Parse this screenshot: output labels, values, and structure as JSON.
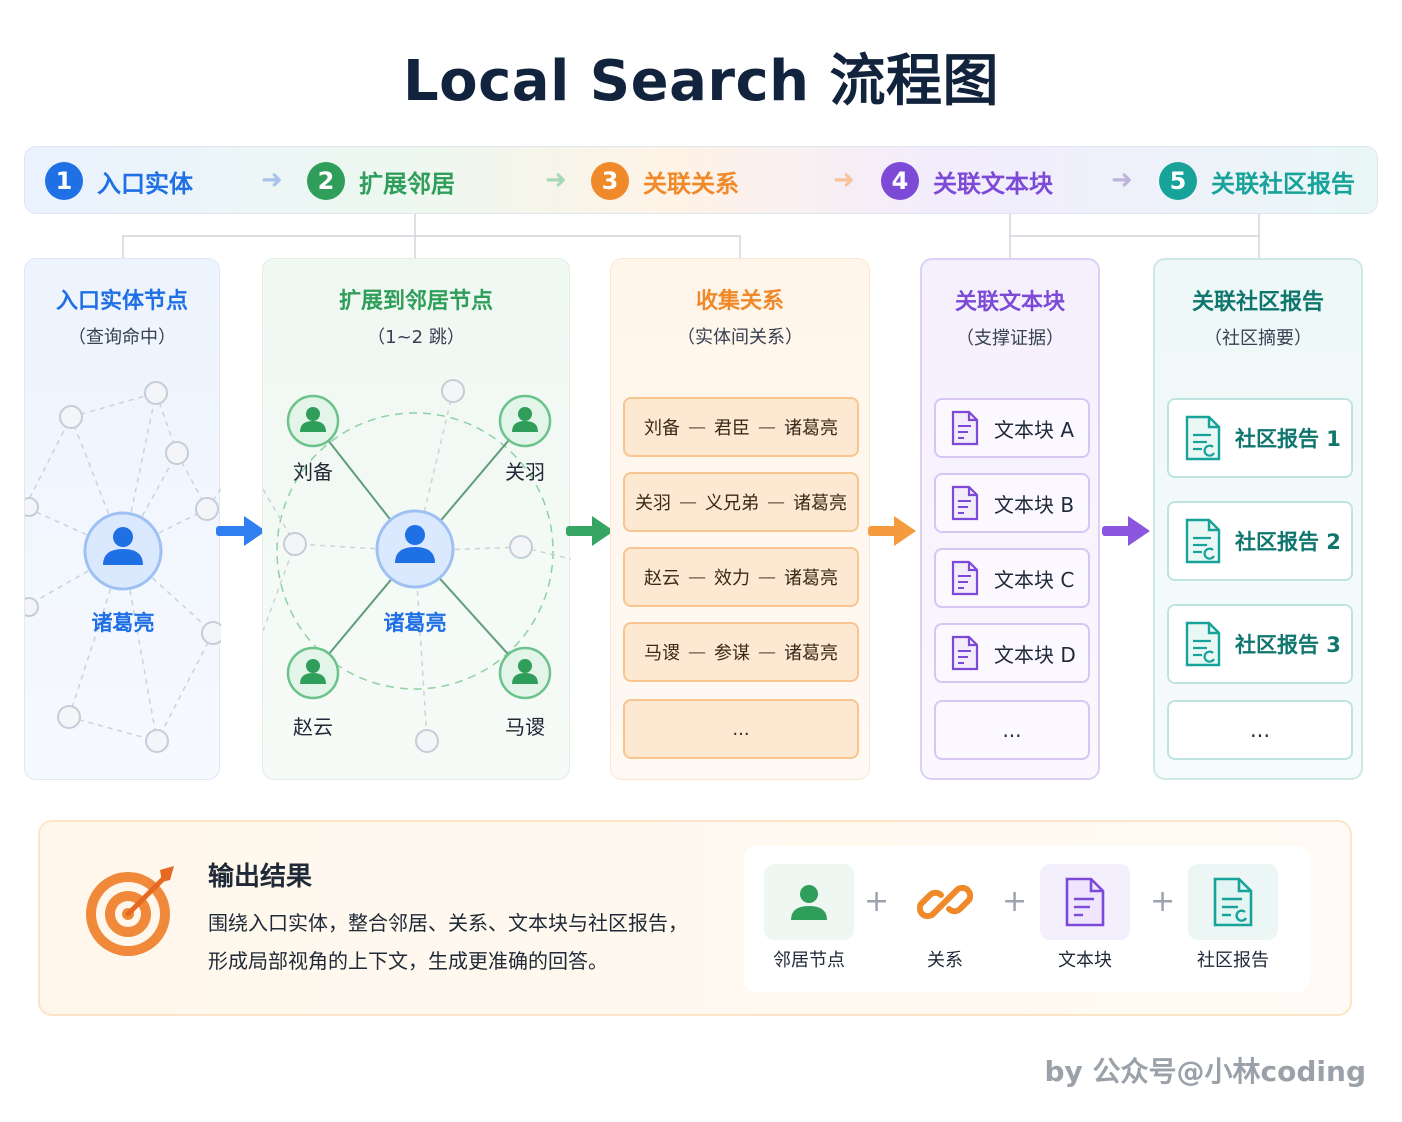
{
  "title": "Local Search 流程图",
  "steps": [
    {
      "num": "1",
      "label": "入口实体",
      "color": "#1f6fe5"
    },
    {
      "num": "2",
      "label": "扩展邻居",
      "color": "#2f9e5a"
    },
    {
      "num": "3",
      "label": "关联关系",
      "color": "#f0892a"
    },
    {
      "num": "4",
      "label": "关联文本块",
      "color": "#7c4ad6"
    },
    {
      "num": "5",
      "label": "关联社区报告",
      "color": "#18a39a"
    }
  ],
  "panels": {
    "entry": {
      "title": "入口实体节点",
      "sub": "（查询命中）",
      "center": "诸葛亮"
    },
    "expand": {
      "title": "扩展到邻居节点",
      "sub": "（1~2 跳）",
      "center": "诸葛亮",
      "neighbors": [
        "刘备",
        "关羽",
        "赵云",
        "马谡"
      ]
    },
    "relations": {
      "title": "收集关系",
      "sub": "（实体间关系）",
      "items": [
        {
          "a": "刘备",
          "rel": "君臣",
          "b": "诸葛亮"
        },
        {
          "a": "关羽",
          "rel": "义兄弟",
          "b": "诸葛亮"
        },
        {
          "a": "赵云",
          "rel": "效力",
          "b": "诸葛亮"
        },
        {
          "a": "马谡",
          "rel": "参谋",
          "b": "诸葛亮"
        }
      ],
      "more": "..."
    },
    "chunks": {
      "title": "关联文本块",
      "sub": "（支撑证据）",
      "items": [
        "文本块 A",
        "文本块 B",
        "文本块 C",
        "文本块 D"
      ],
      "more": "..."
    },
    "community": {
      "title": "关联社区报告",
      "sub": "（社区摘要）",
      "items": [
        "社区报告 1",
        "社区报告 2",
        "社区报告 3"
      ],
      "more": "..."
    }
  },
  "output": {
    "title": "输出结果",
    "desc_line1": "围绕入口实体，整合邻居、关系、文本块与社区报告，",
    "desc_line2": "形成局部视角的上下文，生成更准确的回答。",
    "legend": [
      "邻居节点",
      "关系",
      "文本块",
      "社区报告"
    ],
    "plus": "+"
  },
  "credit": "by 公众号@小林coding"
}
